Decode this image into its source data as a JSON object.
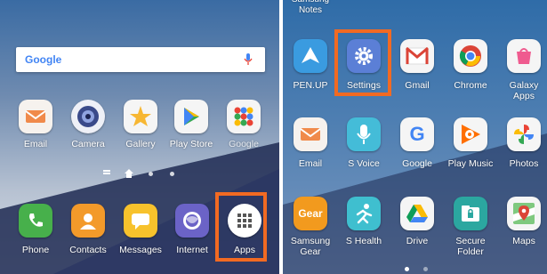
{
  "left": {
    "search": {
      "logo": "Google",
      "mic_icon": "mic-icon"
    },
    "home_apps": [
      {
        "label": "Email",
        "icon": "email-icon",
        "color": "#f6f2ee"
      },
      {
        "label": "Camera",
        "icon": "camera-icon",
        "color": "#eef0f7"
      },
      {
        "label": "Gallery",
        "icon": "gallery-icon",
        "color": "#f5f5f5"
      },
      {
        "label": "Play Store",
        "icon": "play-store-icon",
        "color": "#f5f5f5"
      },
      {
        "label": "Google",
        "icon": "google-folder-icon",
        "color": "#f5f5f5"
      }
    ],
    "dock_apps": [
      {
        "label": "Phone",
        "icon": "phone-icon",
        "color": "#47b04b"
      },
      {
        "label": "Contacts",
        "icon": "contacts-icon",
        "color": "#f39a2a"
      },
      {
        "label": "Messages",
        "icon": "messages-icon",
        "color": "#f7c22c"
      },
      {
        "label": "Internet",
        "icon": "internet-icon",
        "color": "#6b63c7"
      },
      {
        "label": "Apps",
        "icon": "apps-grid-icon",
        "color": "#ffffff"
      }
    ],
    "highlight_color": "#f26a22"
  },
  "right": {
    "top_partial": [
      {
        "label": "Samsung Notes"
      }
    ],
    "rows": [
      [
        {
          "label": "PEN.UP",
          "icon": "penup-icon",
          "color": "#3a9be0"
        },
        {
          "label": "Settings",
          "icon": "settings-gear-icon",
          "color": "#5b7fd6"
        },
        {
          "label": "Gmail",
          "icon": "gmail-icon",
          "color": "#f5f5f5"
        },
        {
          "label": "Chrome",
          "icon": "chrome-icon",
          "color": "#f5f5f5"
        },
        {
          "label": "Galaxy Apps",
          "icon": "galaxy-apps-icon",
          "color": "#f5f5f5"
        }
      ],
      [
        {
          "label": "Email",
          "icon": "email-icon",
          "color": "#f6f2ee"
        },
        {
          "label": "S Voice",
          "icon": "svoice-icon",
          "color": "#44bcd8"
        },
        {
          "label": "Google",
          "icon": "google-icon",
          "color": "#f5f5f5"
        },
        {
          "label": "Play Music",
          "icon": "play-music-icon",
          "color": "#f5f5f5"
        },
        {
          "label": "Photos",
          "icon": "photos-icon",
          "color": "#f5f5f5"
        }
      ],
      [
        {
          "label": "Samsung Gear",
          "label_lines": [
            "Samsung",
            "Gear"
          ],
          "icon": "gear-app-icon",
          "color": "#f29a1e"
        },
        {
          "label": "S Health",
          "icon": "shealth-icon",
          "color": "#3fbfcf"
        },
        {
          "label": "Drive",
          "icon": "drive-icon",
          "color": "#f5f5f5"
        },
        {
          "label": "Secure Folder",
          "label_lines": [
            "Secure",
            "Folder"
          ],
          "icon": "secure-folder-icon",
          "color": "#2ba7a0"
        },
        {
          "label": "Maps",
          "icon": "maps-icon",
          "color": "#f5f5f5"
        }
      ]
    ],
    "highlight_color": "#f26a22"
  }
}
